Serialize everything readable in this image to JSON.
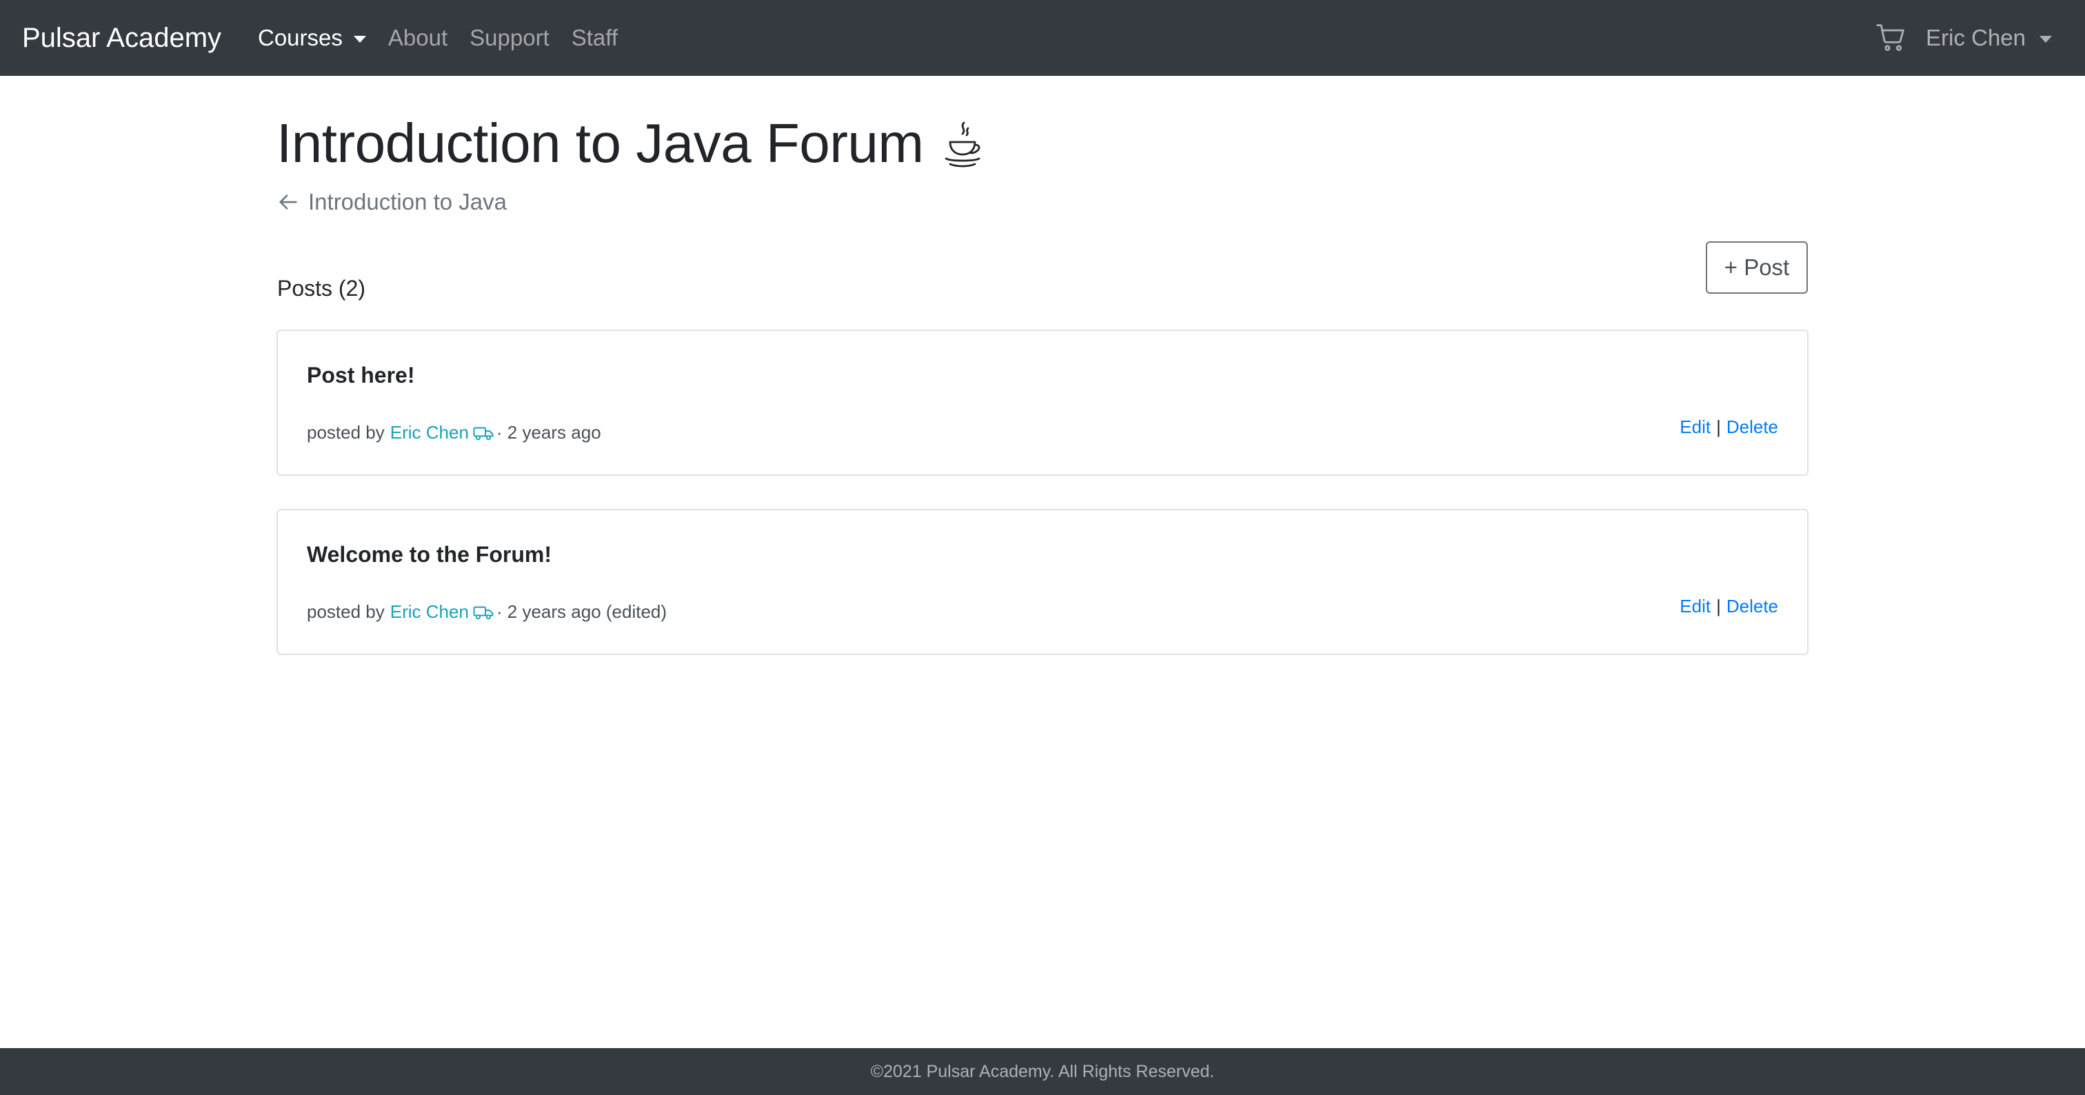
{
  "navbar": {
    "brand": "Pulsar Academy",
    "links": [
      {
        "label": "Courses",
        "active": true,
        "dropdown": true
      },
      {
        "label": "About"
      },
      {
        "label": "Support"
      },
      {
        "label": "Staff"
      }
    ],
    "cart_icon": "shopping-cart-icon",
    "user_name": "Eric Chen"
  },
  "page": {
    "title": "Introduction to Java Forum",
    "title_icon": "java-coffee-cup-icon",
    "back_link": "Introduction to Java",
    "posts_heading": "Posts (2)",
    "new_post_button": "+ Post"
  },
  "posts": [
    {
      "title": "Post here!",
      "posted_by_prefix": "posted by",
      "author": "Eric Chen",
      "author_icon": "truck-icon",
      "time_suffix": "· 2 years ago",
      "edit": "Edit",
      "separator": "|",
      "delete": "Delete"
    },
    {
      "title": "Welcome to the Forum!",
      "posted_by_prefix": "posted by",
      "author": "Eric Chen",
      "author_icon": "truck-icon",
      "time_suffix": "· 2 years ago (edited)",
      "edit": "Edit",
      "separator": "|",
      "delete": "Delete"
    }
  ],
  "footer": {
    "text": "©2021 Pulsar Academy. All Rights Reserved."
  },
  "colors": {
    "navbar_bg": "#343a40",
    "link_blue": "#007bff",
    "author_teal": "#17a2b8",
    "muted": "#6c757d"
  }
}
